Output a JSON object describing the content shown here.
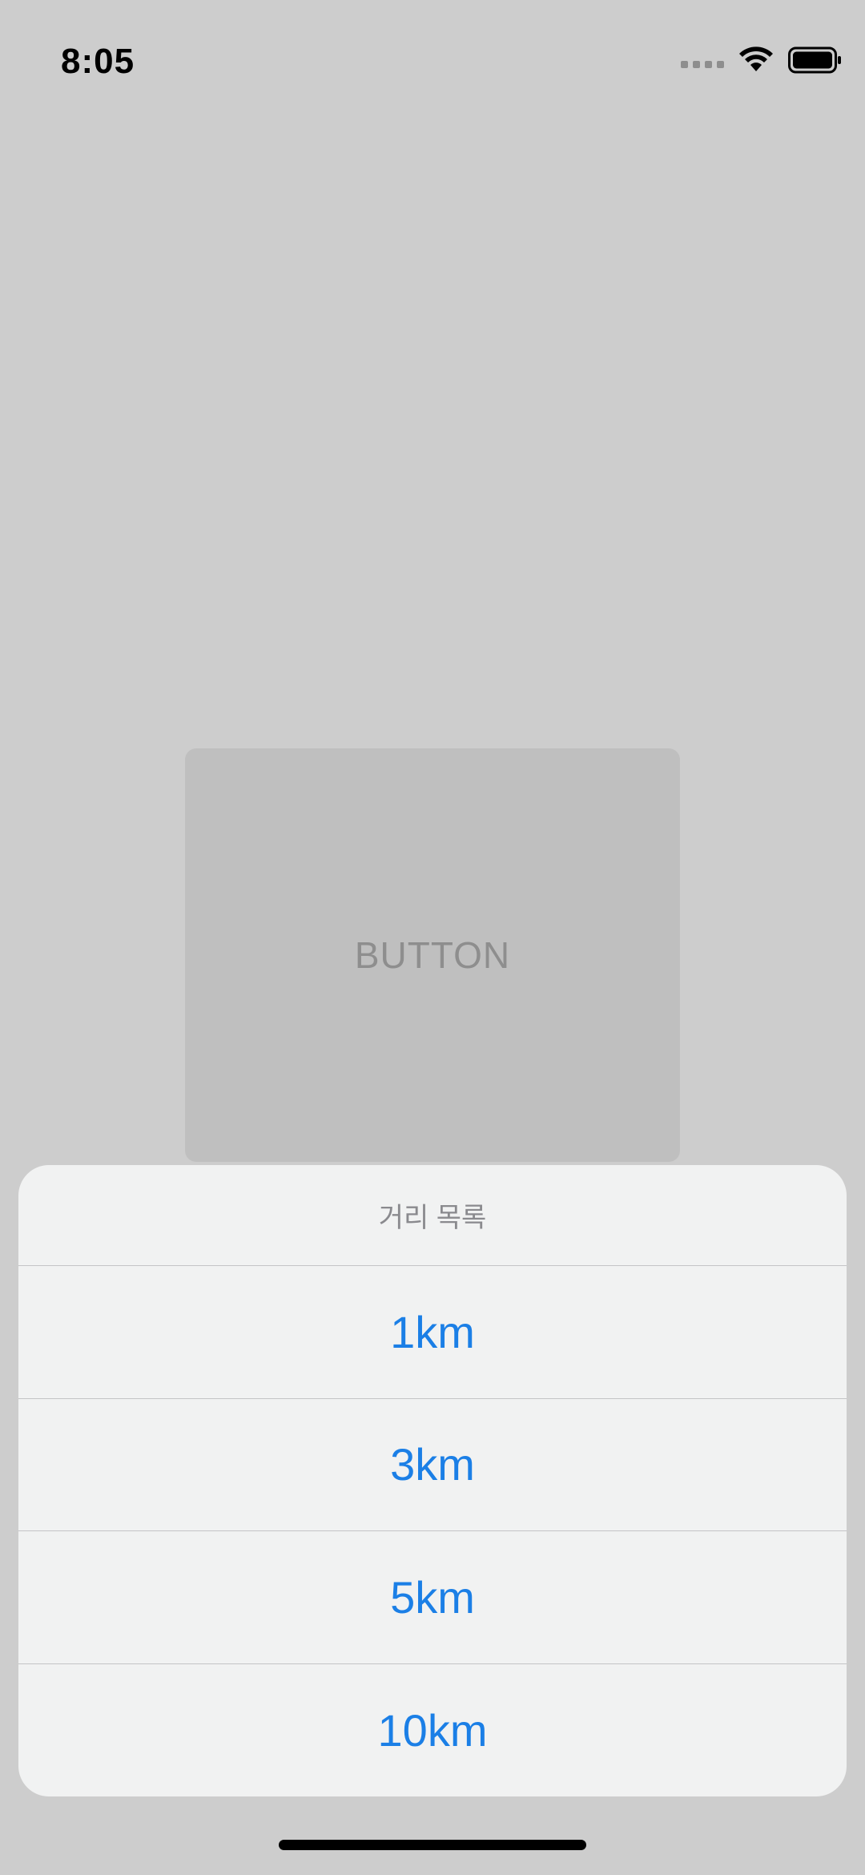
{
  "status_bar": {
    "time": "8:05",
    "icons": [
      "cellular-signal-icon",
      "wifi-icon",
      "battery-icon"
    ]
  },
  "main": {
    "button_label": "BUTTON"
  },
  "action_sheet": {
    "title": "거리 목록",
    "options": [
      {
        "label": "1km"
      },
      {
        "label": "3km"
      },
      {
        "label": "5km"
      },
      {
        "label": "10km"
      }
    ]
  },
  "colors": {
    "accent": "#1b7fe6",
    "dim_background": "#cdcdcd",
    "sheet_background": "#f1f2f2"
  }
}
